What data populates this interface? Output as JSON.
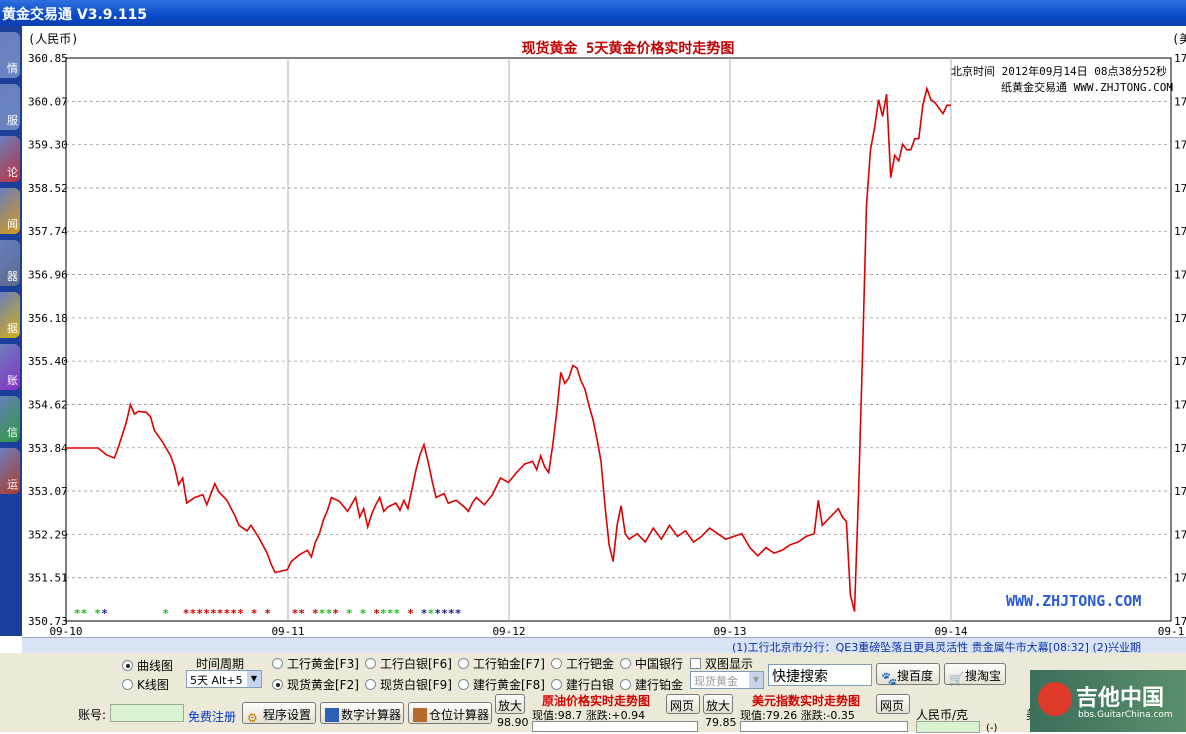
{
  "window": {
    "title": "黄金交易通 V3.9.115"
  },
  "sidebar": {
    "items": [
      {
        "label": "情",
        "icon": "gold-bar-icon",
        "color": "#6a86c4"
      },
      {
        "label": "服",
        "icon": "service-icon",
        "color": "#6a86c4"
      },
      {
        "label": "论",
        "icon": "forum-icon",
        "color": "#c0303a"
      },
      {
        "label": "闻",
        "icon": "news-icon",
        "color": "#d89a16"
      },
      {
        "label": "器",
        "icon": "tools-icon",
        "color": "#5a6a8a"
      },
      {
        "label": "据",
        "icon": "data-icon",
        "color": "#d8b010"
      },
      {
        "label": "账",
        "icon": "account-icon",
        "color": "#8a2ec4"
      },
      {
        "label": "信",
        "icon": "message-icon",
        "color": "#2a9a3a"
      },
      {
        "label": "运",
        "icon": "fortune-icon",
        "color": "#b03a2a"
      }
    ]
  },
  "chart_data": {
    "type": "line",
    "title": "现货黄金 5天黄金价格实时走势图",
    "ylabel": "(人民币)",
    "ylabel_right": "(美",
    "y_ticks": [
      "360.85",
      "360.07",
      "359.30",
      "358.52",
      "357.74",
      "356.96",
      "356.18",
      "355.40",
      "354.62",
      "353.84",
      "353.07",
      "352.29",
      "351.51",
      "350.73"
    ],
    "right_tick_label": "17",
    "x_ticks": [
      "09-10",
      "09-11",
      "09-12",
      "09-13",
      "09-14",
      "09-1"
    ],
    "ylim": [
      350.73,
      360.85
    ],
    "grid": true,
    "timestamp_label": "北京时间 2012年09月14日 08点38分52秒",
    "brand_label": "纸黄金交易通 WWW.ZHJTONG.COM",
    "watermark": "WWW.ZHJTONG.COM",
    "line_color": "#dd0000",
    "series": [
      {
        "values": [
          [
            0,
            353.84
          ],
          [
            4,
            353.84
          ],
          [
            8,
            353.84
          ],
          [
            10,
            353.72
          ],
          [
            12,
            353.66
          ],
          [
            13,
            353.85
          ],
          [
            15,
            354.3
          ],
          [
            16,
            354.62
          ],
          [
            17,
            354.45
          ],
          [
            18,
            354.5
          ],
          [
            20,
            354.48
          ],
          [
            21,
            354.4
          ],
          [
            22,
            354.15
          ],
          [
            24,
            353.95
          ],
          [
            26,
            353.7
          ],
          [
            27,
            353.5
          ],
          [
            28,
            353.18
          ],
          [
            29,
            353.3
          ],
          [
            30,
            352.85
          ],
          [
            32,
            352.95
          ],
          [
            34,
            353.0
          ],
          [
            35,
            352.82
          ],
          [
            37,
            353.2
          ],
          [
            38,
            353.05
          ],
          [
            40,
            352.9
          ],
          [
            42,
            352.62
          ],
          [
            43,
            352.45
          ],
          [
            45,
            352.35
          ],
          [
            46,
            352.45
          ],
          [
            48,
            352.22
          ],
          [
            50,
            351.95
          ],
          [
            51,
            351.75
          ],
          [
            52,
            351.6
          ],
          [
            53,
            351.62
          ],
          [
            55,
            351.65
          ],
          [
            56,
            351.8
          ],
          [
            58,
            351.92
          ],
          [
            60,
            352.0
          ],
          [
            61,
            351.88
          ],
          [
            62,
            352.15
          ],
          [
            63,
            352.3
          ],
          [
            64,
            352.55
          ],
          [
            65,
            352.72
          ],
          [
            66,
            352.95
          ],
          [
            68,
            352.88
          ],
          [
            70,
            352.7
          ],
          [
            72,
            352.95
          ],
          [
            73,
            352.6
          ],
          [
            74,
            352.75
          ],
          [
            75,
            352.42
          ],
          [
            76,
            352.65
          ],
          [
            77,
            352.82
          ],
          [
            78,
            352.95
          ],
          [
            79,
            352.7
          ],
          [
            80,
            352.78
          ],
          [
            82,
            352.85
          ],
          [
            83,
            352.72
          ],
          [
            84,
            352.9
          ],
          [
            85,
            352.75
          ],
          [
            86,
            353.1
          ],
          [
            87,
            353.45
          ],
          [
            88,
            353.72
          ],
          [
            89,
            353.9
          ],
          [
            90,
            353.6
          ],
          [
            91,
            353.25
          ],
          [
            92,
            352.95
          ],
          [
            94,
            353.02
          ],
          [
            95,
            352.85
          ],
          [
            97,
            352.9
          ],
          [
            99,
            352.78
          ],
          [
            100,
            352.7
          ],
          [
            101,
            352.85
          ],
          [
            102,
            352.95
          ],
          [
            104,
            352.82
          ],
          [
            106,
            353.0
          ],
          [
            107,
            353.15
          ],
          [
            108,
            353.3
          ],
          [
            110,
            353.22
          ],
          [
            112,
            353.4
          ],
          [
            114,
            353.55
          ],
          [
            116,
            353.6
          ],
          [
            117,
            353.45
          ],
          [
            118,
            353.7
          ],
          [
            119,
            353.5
          ],
          [
            120,
            353.4
          ],
          [
            121,
            353.9
          ],
          [
            122,
            354.5
          ],
          [
            123,
            355.2
          ],
          [
            124,
            355.0
          ],
          [
            125,
            355.1
          ],
          [
            126,
            355.32
          ],
          [
            127,
            355.28
          ],
          [
            128,
            355.05
          ],
          [
            129,
            354.9
          ],
          [
            130,
            354.6
          ],
          [
            131,
            354.35
          ],
          [
            132,
            354.0
          ],
          [
            133,
            353.6
          ],
          [
            134,
            352.8
          ],
          [
            135,
            352.1
          ],
          [
            136,
            351.8
          ],
          [
            137,
            352.45
          ],
          [
            138,
            352.8
          ],
          [
            139,
            352.3
          ],
          [
            140,
            352.2
          ],
          [
            142,
            352.3
          ],
          [
            144,
            352.15
          ],
          [
            146,
            352.4
          ],
          [
            148,
            352.2
          ],
          [
            150,
            352.45
          ],
          [
            152,
            352.25
          ],
          [
            154,
            352.35
          ],
          [
            156,
            352.15
          ],
          [
            158,
            352.25
          ],
          [
            160,
            352.4
          ],
          [
            162,
            352.3
          ],
          [
            164,
            352.2
          ],
          [
            166,
            352.25
          ],
          [
            168,
            352.3
          ],
          [
            170,
            352.05
          ],
          [
            172,
            351.9
          ],
          [
            174,
            352.05
          ],
          [
            176,
            351.95
          ],
          [
            178,
            352.0
          ],
          [
            180,
            352.1
          ],
          [
            182,
            352.15
          ],
          [
            184,
            352.25
          ],
          [
            186,
            352.3
          ],
          [
            187,
            352.9
          ],
          [
            188,
            352.45
          ],
          [
            190,
            352.6
          ],
          [
            192,
            352.75
          ],
          [
            193,
            352.6
          ],
          [
            194,
            352.52
          ],
          [
            195,
            351.2
          ],
          [
            196,
            350.9
          ],
          [
            197,
            353.0
          ],
          [
            198,
            355.5
          ],
          [
            199,
            358.2
          ],
          [
            200,
            359.2
          ],
          [
            201,
            359.6
          ],
          [
            202,
            360.1
          ],
          [
            203,
            359.8
          ],
          [
            204,
            360.2
          ],
          [
            205,
            358.7
          ],
          [
            206,
            359.1
          ],
          [
            207,
            359.0
          ],
          [
            208,
            359.3
          ],
          [
            209,
            359.2
          ],
          [
            210,
            359.2
          ],
          [
            211,
            359.4
          ],
          [
            212,
            359.4
          ],
          [
            213,
            360.0
          ],
          [
            214,
            360.3
          ],
          [
            215,
            360.1
          ],
          [
            216,
            360.05
          ],
          [
            217,
            359.95
          ],
          [
            218,
            359.85
          ],
          [
            219,
            360.0
          ],
          [
            220,
            360.0
          ]
        ]
      }
    ],
    "markers": {
      "rows": [
        [
          "g",
          "g",
          "",
          "g",
          "b",
          "",
          "",
          "",
          "",
          "",
          "",
          "",
          "",
          "g",
          "",
          "",
          "r",
          "r",
          "r",
          "r",
          "r",
          "r",
          "r",
          "r",
          "r",
          "",
          "r",
          "",
          "r",
          "",
          "",
          "",
          "r",
          "r",
          "",
          "r",
          "g",
          "g",
          "r",
          "",
          "g",
          "",
          "g",
          "",
          "r",
          "g",
          "g",
          "g",
          "",
          "r",
          "",
          "b",
          "g",
          "b",
          "b",
          "b",
          "b"
        ]
      ]
    }
  },
  "ticker": {
    "text": "(1)工行北京市分行：QE3重磅坠落且更具灵活性 贵金属牛市大幕[08:32]    (2)兴业期"
  },
  "controls": {
    "chart_type": {
      "curve_label": "曲线图",
      "kline_label": "K线图"
    },
    "period": {
      "label": "时间周期",
      "selected": "5天 Alt+5"
    },
    "products": [
      {
        "label": "工行黄金[F3]",
        "selected": false
      },
      {
        "label": "工行白银[F6]",
        "selected": false
      },
      {
        "label": "工行铂金[F7]",
        "selected": false
      },
      {
        "label": "工行钯金",
        "selected": false
      },
      {
        "label": "中国银行",
        "selected": false
      },
      {
        "label": "现货黄金[F2]",
        "selected": true
      },
      {
        "label": "现货白银[F9]",
        "selected": false
      },
      {
        "label": "建行黄金[F8]",
        "selected": false
      },
      {
        "label": "建行白银",
        "selected": false
      },
      {
        "label": "建行铂金",
        "selected": false
      }
    ],
    "dual_display_label": "双图显示",
    "dual_select": "现货黄金",
    "quick_search_placeholder": "快捷搜索",
    "baidu_label": "搜百度",
    "taobao_label": "搜淘宝",
    "account_label": "账号:",
    "register_label": "免费注册",
    "settings_label": "程序设置",
    "calc_label": "数字计算器",
    "position_calc_label": "仓位计算器",
    "zoom_label_1": "放大",
    "zoom_label_2": "放大",
    "oil": {
      "title": "原油价格实时走势图",
      "value_label": "现值:98.7 涨跌:+0.94",
      "axis_value": "98.90",
      "web_label": "网页"
    },
    "usd": {
      "title": "美元指数实时走势图",
      "value_label": "现值:79.26 涨跌:-0.35",
      "axis_value": "79.85",
      "web_label": "网页"
    },
    "rmb_per_gram": "人民币/克",
    "paren_label": "(-)",
    "right_partial": "美",
    "logo_text": "吉他中国",
    "logo_sub": "bbs.GuitarChina.com"
  }
}
